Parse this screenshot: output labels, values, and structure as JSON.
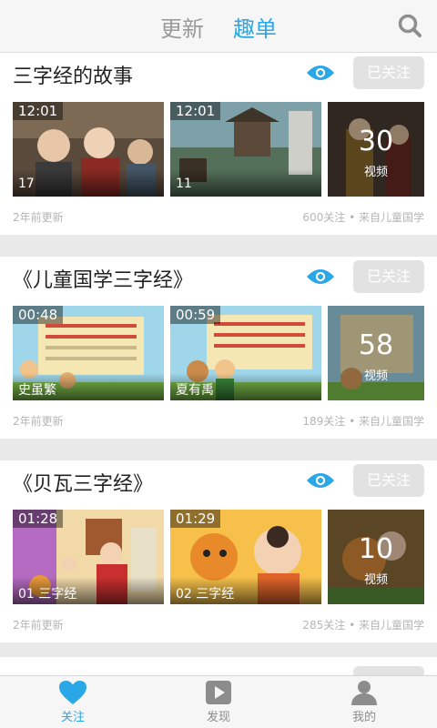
{
  "header": {
    "tabs": [
      {
        "label": "更新",
        "active": false
      },
      {
        "label": "趣单",
        "active": true
      }
    ],
    "search_icon": "search-icon",
    "accent_color": "#2aa7e6"
  },
  "cards": [
    {
      "title": "三字经的故事",
      "follow_label": "已关注",
      "thumbs": [
        {
          "duration": "12:01",
          "caption": "17"
        },
        {
          "duration": "12:01",
          "caption": "11"
        }
      ],
      "count": "30",
      "count_unit": "视频",
      "updated": "2年前更新",
      "stats": "600关注 • 来自儿童国学"
    },
    {
      "title": "《儿童国学三字经》",
      "follow_label": "已关注",
      "thumbs": [
        {
          "duration": "00:48",
          "caption": "史虽繁"
        },
        {
          "duration": "00:59",
          "caption": "夏有禹"
        }
      ],
      "count": "58",
      "count_unit": "视频",
      "updated": "2年前更新",
      "stats": "189关注 • 来自儿童国学"
    },
    {
      "title": "《贝瓦三字经》",
      "follow_label": "已关注",
      "thumbs": [
        {
          "duration": "01:28",
          "caption": "01 三字经"
        },
        {
          "duration": "01:29",
          "caption": "02 三字经"
        }
      ],
      "count": "10",
      "count_unit": "视频",
      "updated": "2年前更新",
      "stats": "285关注 • 来自儿童国学"
    }
  ],
  "bottom_nav": [
    {
      "label": "关注",
      "icon": "heart-icon",
      "active": true
    },
    {
      "label": "发现",
      "icon": "play-icon",
      "active": false
    },
    {
      "label": "我的",
      "icon": "person-icon",
      "active": false
    }
  ]
}
